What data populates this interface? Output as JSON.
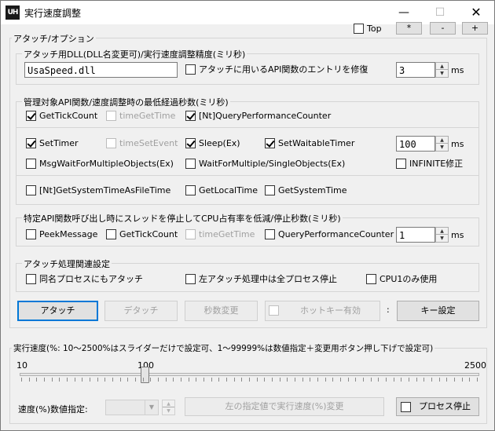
{
  "window": {
    "title": "実行速度調整",
    "icon_text": "UH",
    "minimize_glyph": "—",
    "maximize_glyph": "☐",
    "close_glyph": "✕"
  },
  "top_controls": {
    "top_label": "Top",
    "plus_label": "+",
    "minus_label": "-",
    "star_label": "*"
  },
  "attach_options": {
    "label": "アタッチ/オプション",
    "dll_group": {
      "label": "アタッチ用DLL(DLL名変更可)/実行速度調整精度(ミリ秒)",
      "dll_name": "UsaSpeed.dll",
      "fix_entry_label": "アタッチに用いるAPI関数のエントリを修復",
      "precision_value": "3",
      "precision_unit": "ms"
    },
    "api_group": {
      "label": "管理対象API関数/速度調整時の最低経過秒数(ミリ秒)",
      "row1": [
        {
          "label": "GetTickCount",
          "checked": true,
          "enabled": true
        },
        {
          "label": "timeGetTime",
          "checked": false,
          "enabled": false
        },
        {
          "label": "[Nt]QueryPerformanceCounter",
          "checked": true,
          "enabled": true
        }
      ],
      "row2": [
        {
          "label": "SetTimer",
          "checked": true,
          "enabled": true
        },
        {
          "label": "timeSetEvent",
          "checked": false,
          "enabled": false
        },
        {
          "label": "Sleep(Ex)",
          "checked": true,
          "enabled": true
        },
        {
          "label": "SetWaitableTimer",
          "checked": true,
          "enabled": true
        }
      ],
      "wait_value": "100",
      "wait_unit": "ms",
      "row3": [
        {
          "label": "MsgWaitForMultipleObjects(Ex)",
          "checked": false,
          "enabled": true
        },
        {
          "label": "WaitForMultiple/SingleObjects(Ex)",
          "checked": false,
          "enabled": true
        },
        {
          "label": "INFINITE修正",
          "checked": false,
          "enabled": true
        }
      ],
      "row4": [
        {
          "label": "[Nt]GetSystemTimeAsFileTime",
          "checked": false,
          "enabled": true
        },
        {
          "label": "GetLocalTime",
          "checked": false,
          "enabled": true
        },
        {
          "label": "GetSystemTime",
          "checked": false,
          "enabled": true
        }
      ]
    },
    "thread_group": {
      "label": "特定API関数呼び出し時にスレッドを停止してCPU占有率を低減/停止秒数(ミリ秒)",
      "items": [
        {
          "label": "PeekMessage",
          "checked": false,
          "enabled": true
        },
        {
          "label": "GetTickCount",
          "checked": false,
          "enabled": true
        },
        {
          "label": "timeGetTime",
          "checked": false,
          "enabled": false
        },
        {
          "label": "QueryPerformanceCounter",
          "checked": false,
          "enabled": true
        }
      ],
      "stop_value": "1",
      "stop_unit": "ms"
    },
    "process_group": {
      "label": "アタッチ処理関連設定",
      "items": [
        {
          "label": "同名プロセスにもアタッチ",
          "checked": false,
          "enabled": true
        },
        {
          "label": "左アタッチ処理中は全プロセス停止",
          "checked": false,
          "enabled": true
        },
        {
          "label": "CPU1のみ使用",
          "checked": false,
          "enabled": true
        }
      ]
    },
    "buttons": {
      "attach": "アタッチ",
      "detach": "デタッチ",
      "seconds_change": "秒数変更",
      "hotkey_enable": "ホットキー有効",
      "colon": ":",
      "key_settings": "キー設定"
    }
  },
  "speed": {
    "label": "実行速度(%: 10～2500%はスライダーだけで設定可、1～99999%は数値指定＋変更用ボタン押し下げで設定可)",
    "min_label": "10",
    "mid_label": "100",
    "max_label": "2500",
    "slider_min": 10,
    "slider_max": 2500,
    "slider_value": 100,
    "numeric_label": "速度(%)数値指定:",
    "apply_button": "左の指定値で実行速度(%)変更",
    "process_stop_label": "プロセス停止",
    "process_stop_checked": false
  },
  "colors": {
    "accent": "#0078d7",
    "window_bg": "#f0f0f0",
    "disabled_text": "#a0a0a0"
  }
}
